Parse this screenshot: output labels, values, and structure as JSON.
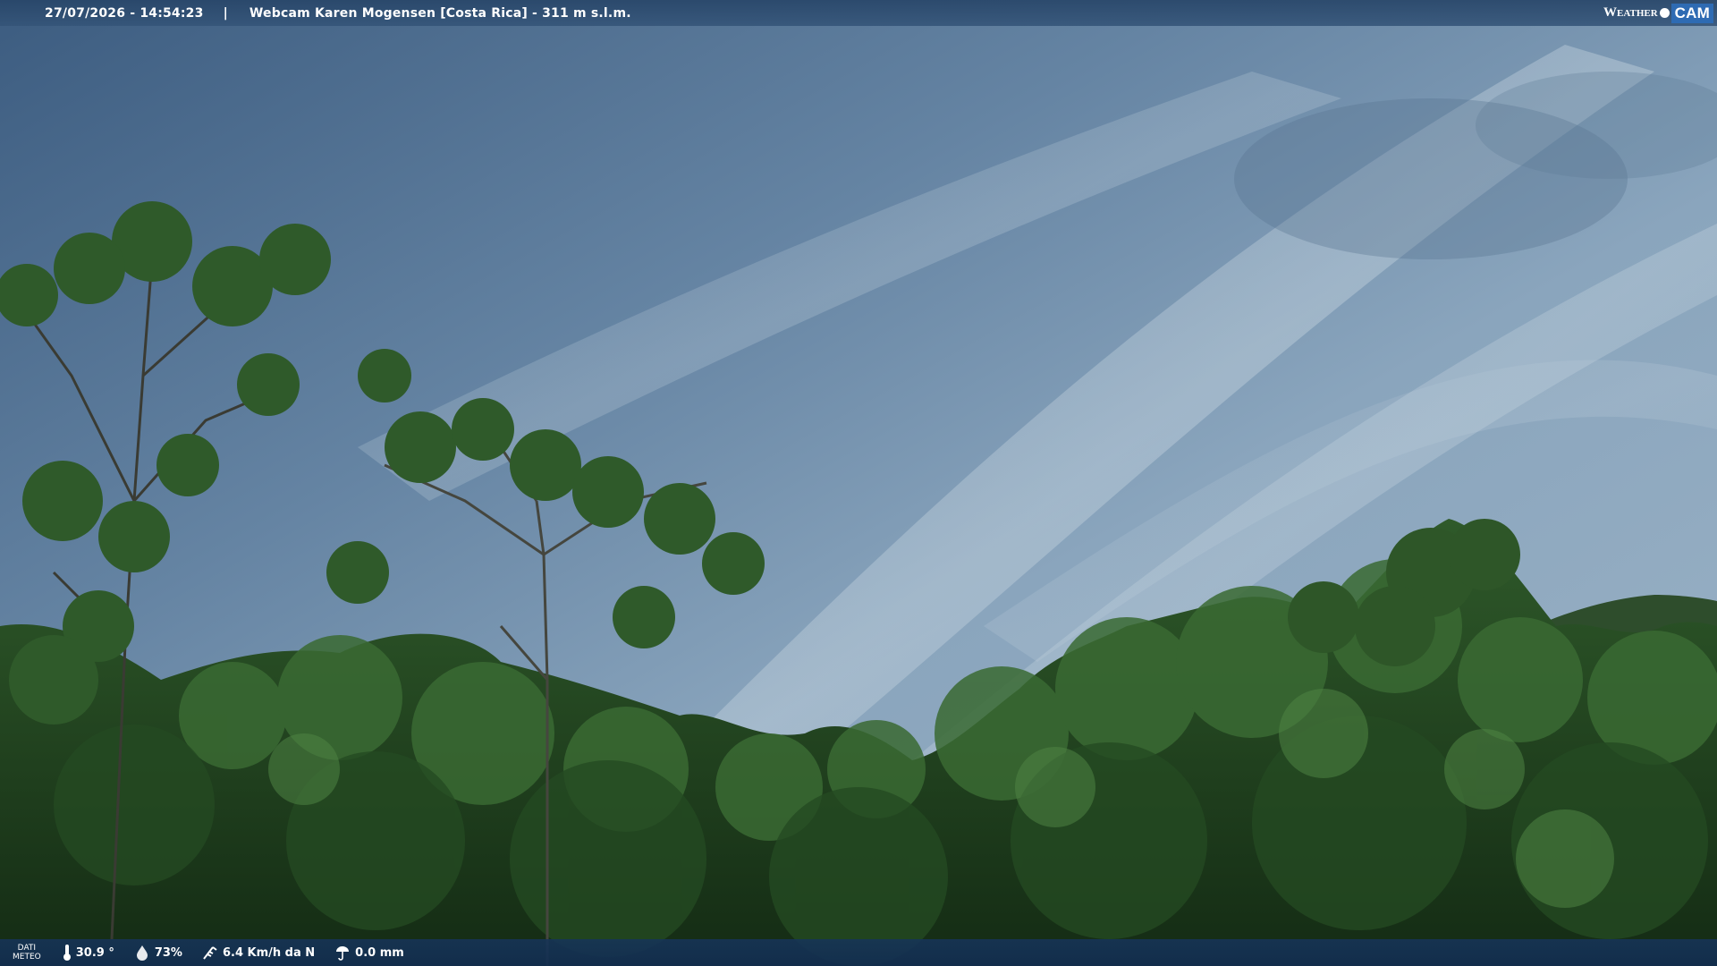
{
  "header": {
    "timestamp": "27/07/2026 - 14:54:23",
    "separator": "|",
    "title": "Webcam Karen Mogensen [Costa Rica] - 311 m s.l.m.",
    "brand_left": "Weather",
    "brand_right": "CAM"
  },
  "footer": {
    "dati_line1": "DATI",
    "dati_line2": "METEO",
    "temperature": "30.9 °",
    "humidity": "73%",
    "wind": "6.4 Km/h da N",
    "rain": "0.0 mm",
    "icons": [
      "thermometer-icon",
      "humidity-icon",
      "wind-icon",
      "rain-icon"
    ]
  },
  "colors": {
    "bar_bg": "#284669",
    "footer_bg": "#163458",
    "brand_accent": "#2e6bb3"
  }
}
